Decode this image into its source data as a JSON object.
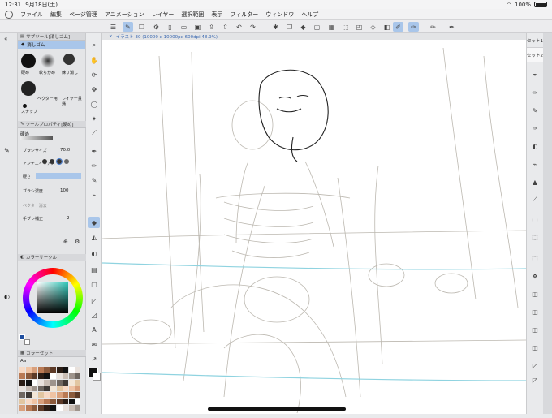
{
  "status": {
    "time": "12:31",
    "date": "9月18日(土)",
    "battery": "100%"
  },
  "menu": [
    "ファイル",
    "編集",
    "ページ管理",
    "アニメーション",
    "レイヤー",
    "選択範囲",
    "表示",
    "フィルター",
    "ウィンドウ",
    "ヘルプ"
  ],
  "subtool": {
    "header": "サブツール[消しゴム]",
    "group_label": "消しゴム",
    "items": [
      {
        "label": "硬め"
      },
      {
        "label": "軟らかめ"
      },
      {
        "label": "練り消し"
      },
      {
        "label": "ベクター用"
      },
      {
        "label": "レイヤー貫通"
      },
      {
        "label": "スナップ"
      }
    ]
  },
  "toolprop": {
    "header": "ツールプロパティ[硬め]",
    "name": "硬め",
    "brush_size_label": "ブラシサイズ",
    "brush_size_value": "70.0",
    "antialias_label": "アンチエイリアス",
    "hardness_label": "硬さ",
    "density_label": "ブラシ濃度",
    "density_value": "100",
    "vector_label": "ベクター消去",
    "stabilize_label": "手ブレ補正",
    "stabilize_value": "2"
  },
  "color_wheel": {
    "header": "カラーサークル"
  },
  "color_set": {
    "header": "カラーセット",
    "set_name": "Aa"
  },
  "canvas": {
    "tab_title": "イラスト-30 (10000 x 10000px 600dpi 48.9%)"
  },
  "right_tabs": [
    "セット1",
    "セット2"
  ],
  "colors": {
    "accent": "#a9c6ea",
    "canvas": "#ffffff",
    "panel": "#e4e5e7"
  }
}
